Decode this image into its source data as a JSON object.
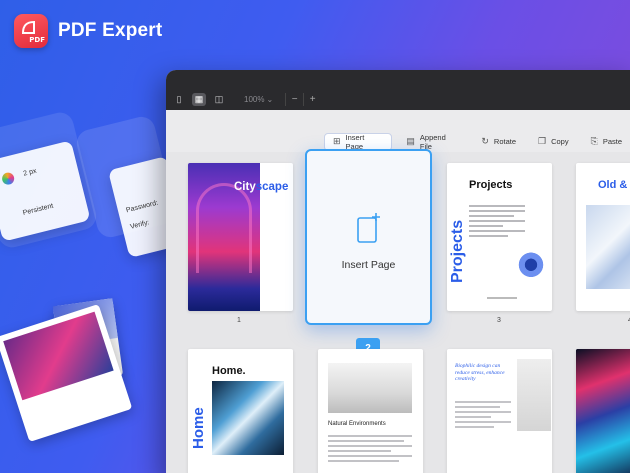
{
  "brand": {
    "name": "PDF Expert",
    "logo_tag": "PDF"
  },
  "decor": {
    "settings_card": {
      "persistent_label": "Persistent",
      "size_label": "2 px"
    },
    "password_card": {
      "password_label": "Password:",
      "verify_label": "Verify:"
    }
  },
  "toolbar": {
    "zoom_value": "100%",
    "zoom_out": "−",
    "zoom_in": "+",
    "actions": [
      {
        "label": "Insert Page",
        "icon": "insert-page-icon",
        "selected": true
      },
      {
        "label": "Append File",
        "icon": "append-file-icon",
        "selected": false
      },
      {
        "label": "Rotate",
        "icon": "rotate-icon",
        "selected": false
      },
      {
        "label": "Copy",
        "icon": "copy-icon",
        "selected": false
      },
      {
        "label": "Paste",
        "icon": "paste-icon",
        "selected": false
      }
    ]
  },
  "pages": [
    {
      "number": "1",
      "title_white": "City",
      "title_blue": "scape"
    },
    {
      "number": "2",
      "label": "Insert Page"
    },
    {
      "number": "3",
      "title": "Projects",
      "vertical_title": "Projects"
    },
    {
      "number": "4",
      "title": "Old &"
    },
    {
      "title": "Home.",
      "vertical_title": "Home"
    },
    {
      "title": "Natural Environments"
    },
    {
      "title": "Biophilic design can reduce stress, enhance creativity"
    },
    {}
  ],
  "colors": {
    "accent": "#2b5de8",
    "selection": "#3ba0f2",
    "brand_red": "#e32b3c"
  }
}
